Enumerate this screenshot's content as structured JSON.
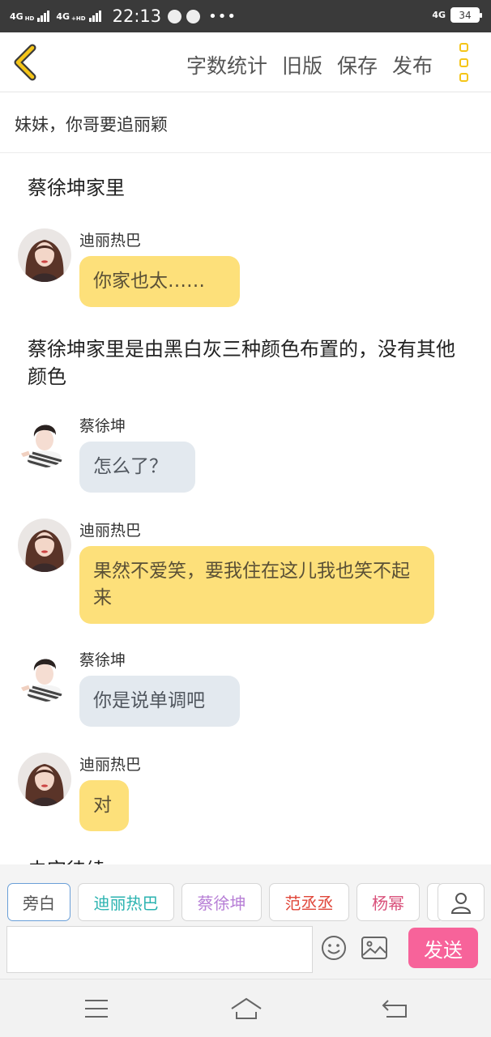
{
  "status_bar": {
    "network_left": "4GHD",
    "network_left2": "4G+HD",
    "time": "22:13",
    "network_right": "4G",
    "battery": "34"
  },
  "toolbar": {
    "actions": [
      "字数统计",
      "旧版",
      "保存",
      "发布"
    ]
  },
  "document": {
    "title": "妹妹，你哥要追丽颖"
  },
  "content": {
    "narration_1": "蔡徐坤家里",
    "narration_2": "蔡徐坤家里是由黑白灰三种颜色布置的，没有其他颜色",
    "messages": [
      {
        "speaker": "迪丽热巴",
        "text": "你家也太……"
      },
      {
        "speaker": "蔡徐坤",
        "text": "怎么了？"
      },
      {
        "speaker": "迪丽热巴",
        "text": "果然不爱笑，要我住在这儿我也笑不起来"
      },
      {
        "speaker": "蔡徐坤",
        "text": "你是说单调吧"
      },
      {
        "speaker": "迪丽热巴",
        "text": "对"
      }
    ],
    "cut_text": "未完待续"
  },
  "characters": [
    {
      "name": "旁白",
      "color": "#555555"
    },
    {
      "name": "迪丽热巴",
      "color": "#2bb3b0"
    },
    {
      "name": "蔡徐坤",
      "color": "#b77fd6"
    },
    {
      "name": "范丞丞",
      "color": "#e0473a"
    },
    {
      "name": "杨幂",
      "color": "#d9507a"
    }
  ],
  "input": {
    "value": "",
    "send_label": "发送"
  },
  "colors": {
    "accent_yellow": "#f5c518",
    "bubble_yellow": "#fde07a",
    "bubble_grey": "#e3e9ef",
    "send_pink": "#f7639a"
  }
}
